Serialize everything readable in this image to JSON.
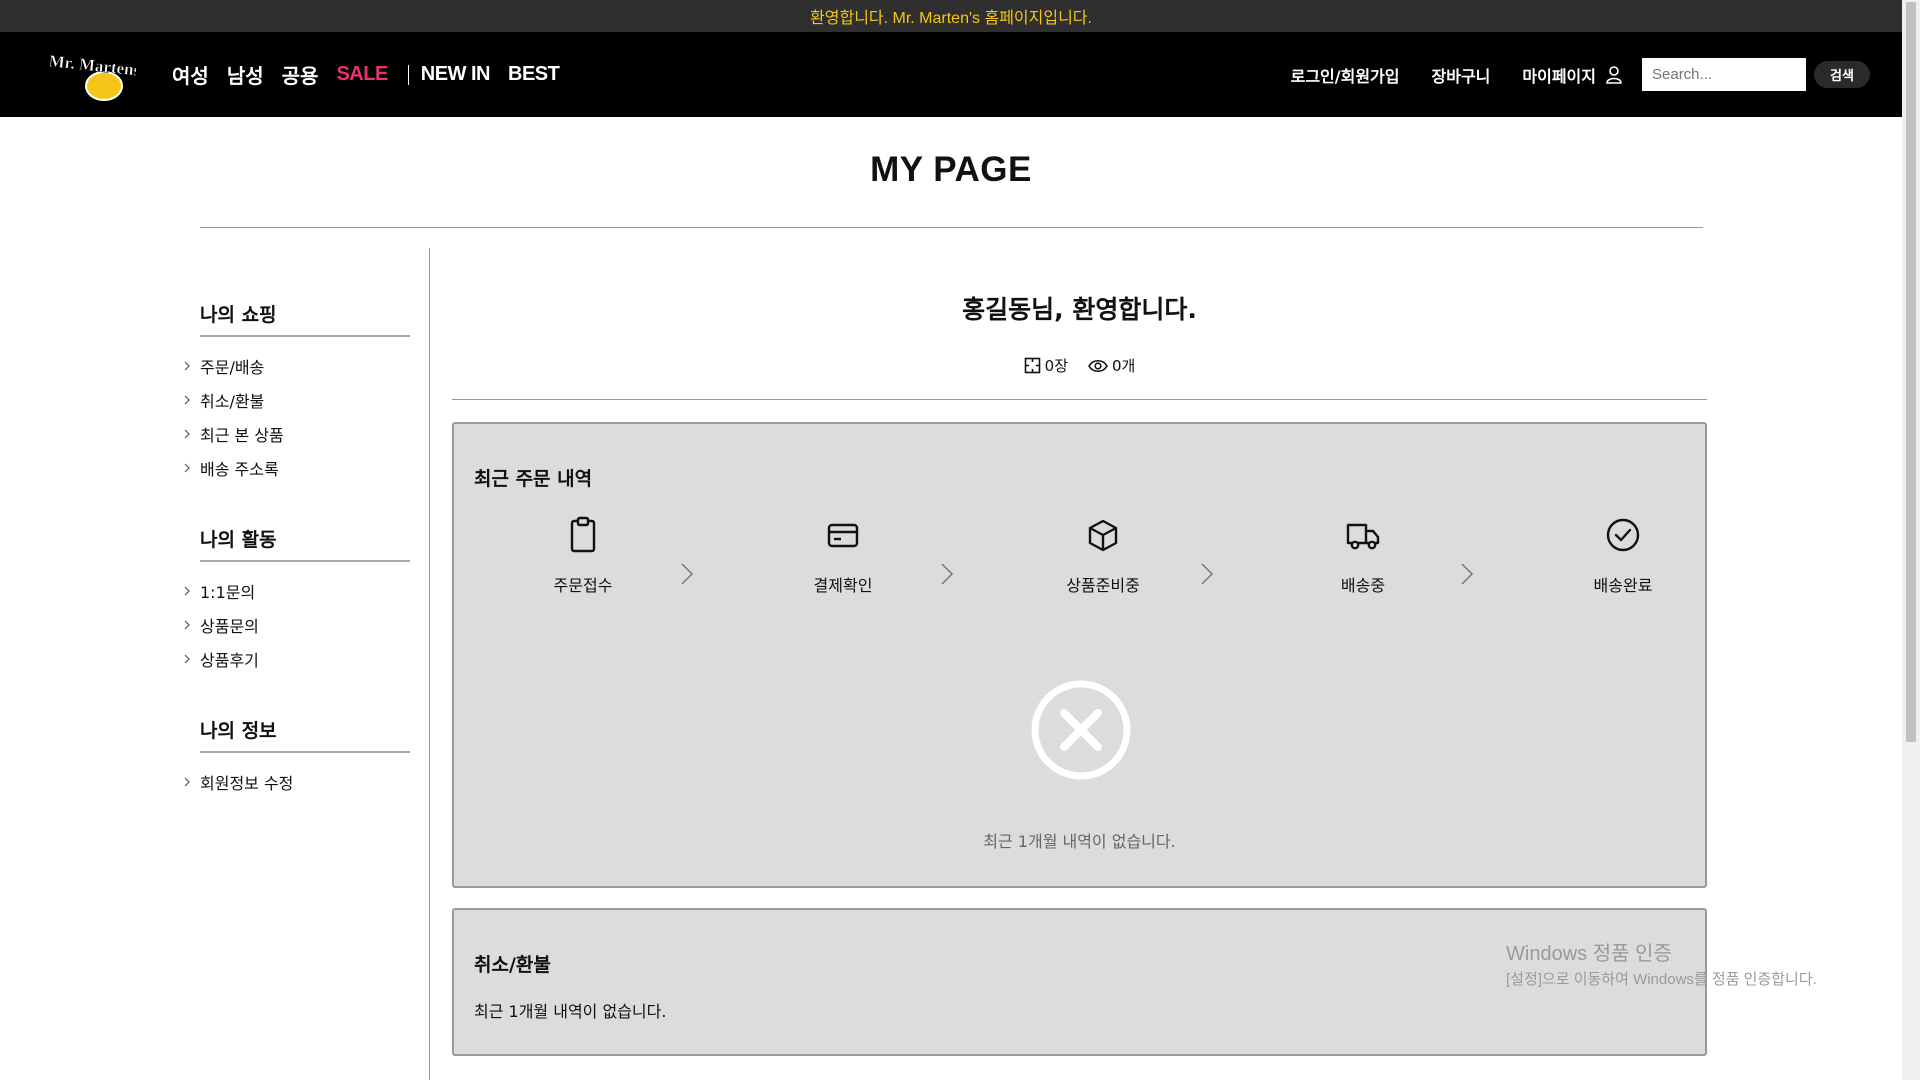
{
  "announcement": "환영합니다. Mr. Marten's 홈페이지입니다.",
  "header": {
    "logo_text": "Mr. Martens",
    "nav": [
      "여성",
      "남성",
      "공용"
    ],
    "sale": "SALE",
    "nav2": [
      "NEW IN",
      "BEST"
    ],
    "login": "로그인/회원가입",
    "cart": "장바구니",
    "mypage": "마이페이지",
    "search_placeholder": "Search...",
    "search_button": "검색"
  },
  "page_title": "MY PAGE",
  "sidebar": {
    "groups": [
      {
        "title": "나의 쇼핑",
        "items": [
          "주문/배송",
          "취소/환불",
          "최근 본 상품",
          "배송 주소록"
        ]
      },
      {
        "title": "나의 활동",
        "items": [
          "1:1문의",
          "상품문의",
          "상품후기"
        ]
      },
      {
        "title": "나의 정보",
        "items": [
          "회원정보 수정"
        ]
      }
    ]
  },
  "welcome": "홍길동님, 환영합니다.",
  "stats": {
    "coupons": "0장",
    "viewed": "0개"
  },
  "orders": {
    "title": "최근 주문 내역",
    "steps": [
      "주문접수",
      "결제확인",
      "상품준비중",
      "배송중",
      "배송완료"
    ],
    "empty": "최근 1개월 내역이 없습니다."
  },
  "cancel": {
    "title": "취소/환불",
    "empty": "최근 1개월 내역이 없습니다."
  },
  "watermark": {
    "line1": "Windows 정품 인증",
    "line2": "[설정]으로 이동하여 Windows를 정품 인증합니다."
  },
  "colors": {
    "accent_yellow": "#f5c518",
    "sale_pink": "#e8336d",
    "panel_bg": "#dcdcdc"
  }
}
